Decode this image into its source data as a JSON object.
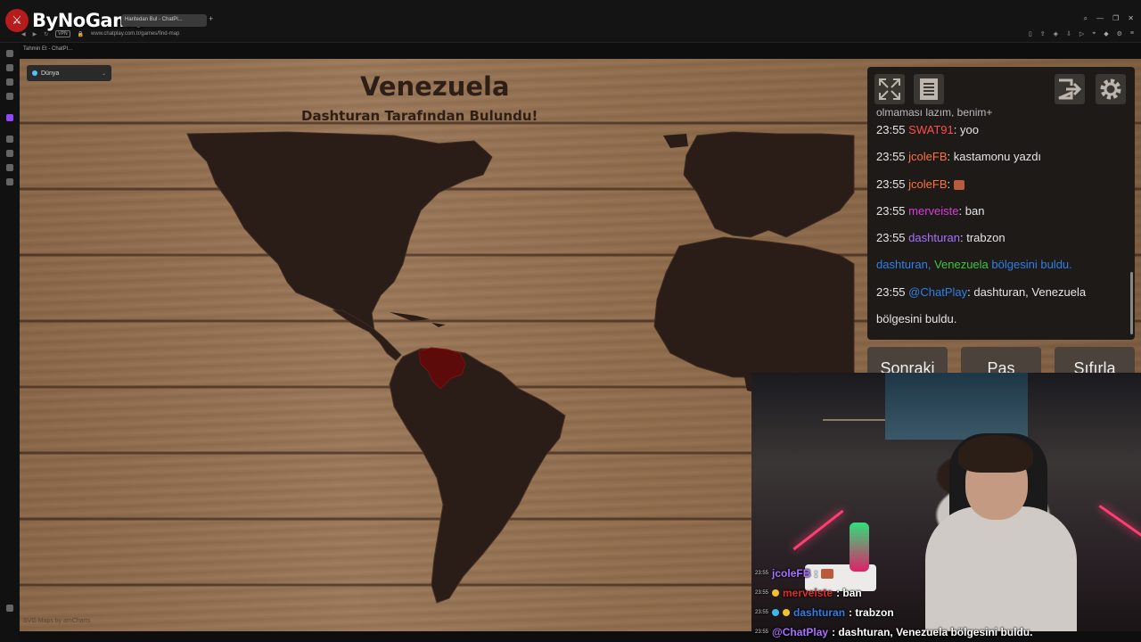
{
  "browser": {
    "logo_text": "ByNoGame",
    "tab_title": "Haritedan Bul - ChatPl...",
    "url": "www.chatplay.com.tr/games/find-map",
    "vpn_label": "VPN",
    "bookmark": "Tahmin Et - ChatPl..."
  },
  "game": {
    "world_select": "Dünya",
    "country": "Venezuela",
    "found_by": "Dashturan Tarafından Bulundu!",
    "credit": "SVG Maps by amCharts",
    "highlight_color": "#5c0a0a",
    "land_color": "#2a1c16"
  },
  "chat": {
    "partial_line": "olmaması lazım, benim+",
    "lines": [
      {
        "time": "23:55",
        "user": "SWAT91",
        "color": "red",
        "text": ": yoo"
      },
      {
        "time": "23:55",
        "user": "jcoleFB",
        "color": "orange",
        "text": ": kastamonu yazdı"
      },
      {
        "time": "23:55",
        "user": "jcoleFB",
        "color": "orange",
        "text": ": ",
        "emote": true
      },
      {
        "time": "23:55",
        "user": "merveiste",
        "color": "pink",
        "text": ": ban"
      },
      {
        "time": "23:55",
        "user": "dashturan",
        "color": "purple",
        "text": ": trabzon"
      }
    ],
    "system": {
      "user": "dashturan,",
      "country": "Venezuela",
      "rest": "bölgesini buldu."
    },
    "bot": {
      "time": "23:55",
      "user": "@ChatPlay",
      "text": ": dashturan, Venezuela",
      "cont": "bölgesini buldu."
    }
  },
  "buttons": {
    "next": "Sonraki",
    "pass": "Pas",
    "reset": "Sıfırla"
  },
  "overlay": [
    {
      "time": "23:55",
      "user": "jcoleFB",
      "color": "#a970ff",
      "text": ":"
    },
    {
      "time": "23:55",
      "user": "merveiste",
      "color": "#e02b2b",
      "text": ": ban"
    },
    {
      "time": "23:55",
      "user": "dashturan",
      "color": "#2f7fe8",
      "text": ": trabzon"
    },
    {
      "time": "23:55",
      "user": "@ChatPlay",
      "color": "#a970ff",
      "text": ": dashturan, Venezuela bölgesini buldu."
    }
  ]
}
